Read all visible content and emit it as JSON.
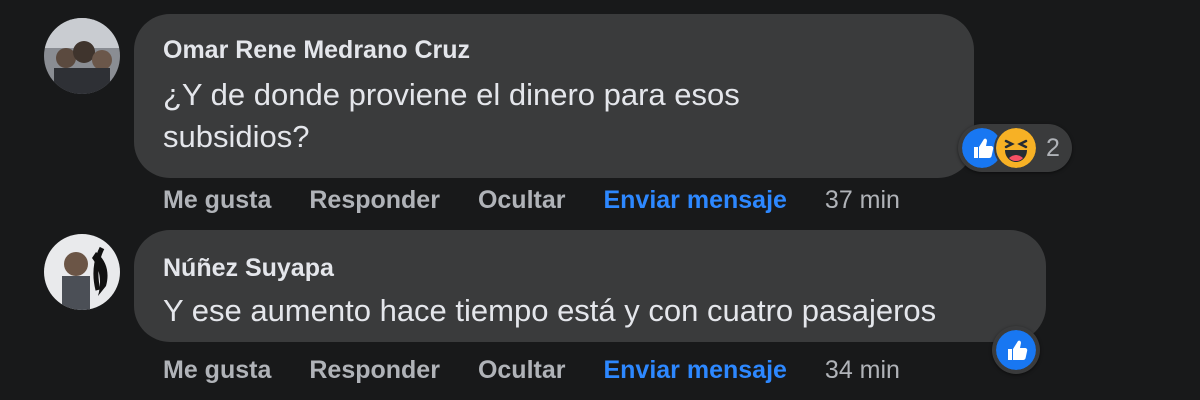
{
  "comments": [
    {
      "author": "Omar Rene Medrano Cruz",
      "text_line1": "¿Y de donde proviene el dinero para esos",
      "text_line2": "subsidios?",
      "reaction_count": "2",
      "actions": {
        "like": "Me gusta",
        "reply": "Responder",
        "hide": "Ocultar",
        "message": "Enviar mensaje",
        "time": "37 min"
      }
    },
    {
      "author": "Núñez Suyapa",
      "text_line1": "Y ese aumento hace tiempo está y con cuatro pasajeros",
      "actions": {
        "like": "Me gusta",
        "reply": "Responder",
        "hide": "Ocultar",
        "message": "Enviar mensaje",
        "time": "34 min"
      }
    }
  ],
  "colors": {
    "background": "#18191a",
    "bubble": "#3a3b3c",
    "text": "#e4e6eb",
    "muted": "#b0b3b8",
    "link": "#2d88ff",
    "like": "#1877f2",
    "haha": "#f7b125"
  },
  "icons": {
    "reaction_1": "like-icon",
    "reaction_2": "haha-icon"
  }
}
